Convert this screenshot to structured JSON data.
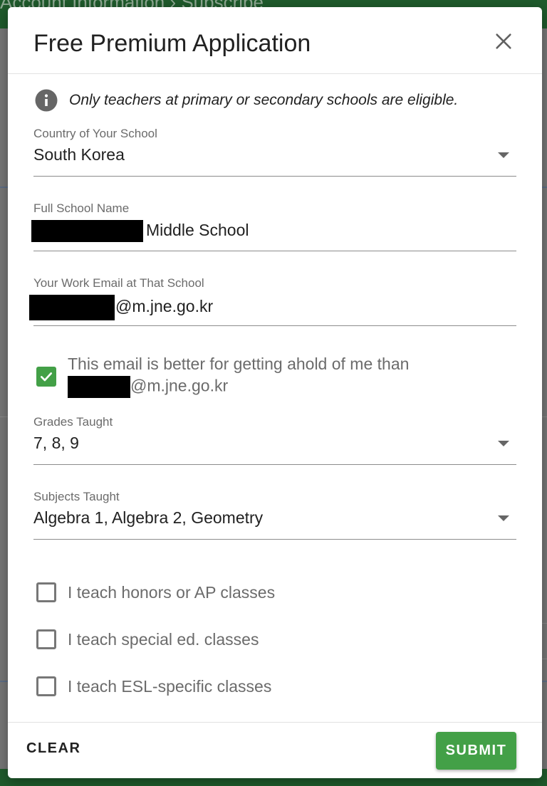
{
  "background": {
    "breadcrumb": "Account Information  ›  Subscribe"
  },
  "modal": {
    "title": "Free Premium Application",
    "notice": "Only teachers at primary or secondary schools are eligible.",
    "fields": {
      "country": {
        "label": "Country of Your School",
        "value": "South Korea"
      },
      "school_name": {
        "label": "Full School Name",
        "value_suffix": "Middle School"
      },
      "work_email": {
        "label": "Your Work Email at That School",
        "value_suffix": "@m.jne.go.kr"
      },
      "grades": {
        "label": "Grades Taught",
        "value": "7, 8, 9"
      },
      "subjects": {
        "label": "Subjects Taught",
        "value": "Algebra 1, Algebra 2, Geometry"
      }
    },
    "email_preference": {
      "checked": true,
      "line1": "This email is better for getting ahold of me than",
      "line2_suffix": "@m.jne.go.kr"
    },
    "checkboxes": [
      {
        "label": "I teach honors or AP classes",
        "checked": false
      },
      {
        "label": "I teach special ed. classes",
        "checked": false
      },
      {
        "label": "I teach ESL-specific classes",
        "checked": false
      }
    ],
    "footer": {
      "clear_label": "CLEAR",
      "submit_label": "SUBMIT"
    }
  },
  "colors": {
    "accent": "#43a047",
    "header_bar": "#1f5b2c"
  }
}
